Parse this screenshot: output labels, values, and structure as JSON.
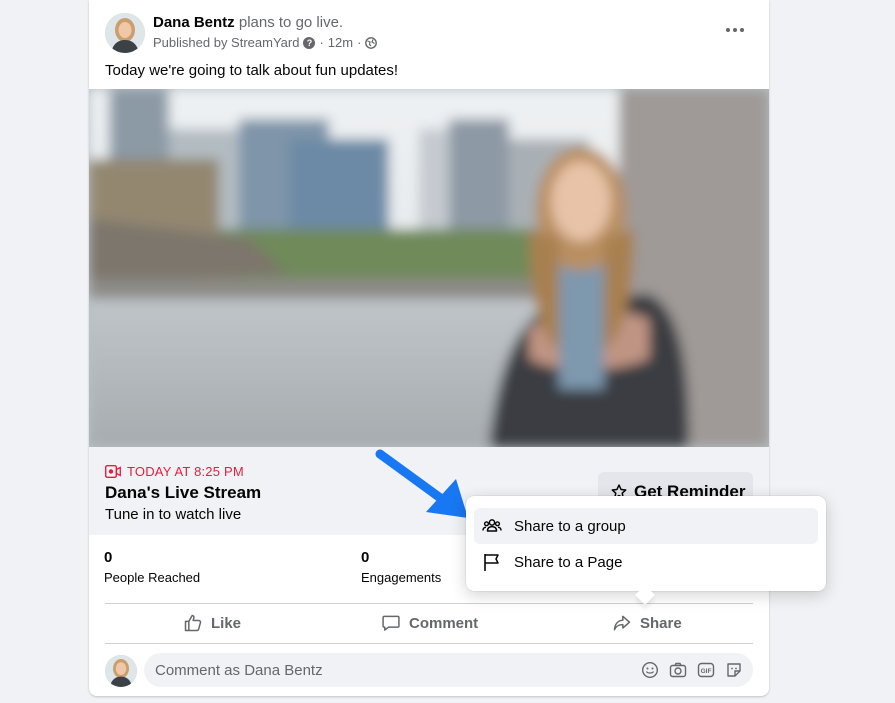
{
  "post": {
    "author": "Dana Bentz",
    "verb": "plans to go live.",
    "published_by": "Published by StreamYard",
    "time": "12m",
    "text": "Today we're going to talk about fun updates!"
  },
  "event": {
    "when": "TODAY AT 8:25 PM",
    "title": "Dana's Live Stream",
    "subtitle": "Tune in to watch live",
    "reminder_label": "Get Reminder"
  },
  "stats": [
    {
      "value": "0",
      "label": "People Reached"
    },
    {
      "value": "0",
      "label": "Engagements"
    }
  ],
  "actions": {
    "like": "Like",
    "comment": "Comment",
    "share": "Share"
  },
  "comment_box": {
    "placeholder": "Comment as Dana Bentz"
  },
  "share_menu": {
    "items": [
      {
        "label": "Share to a group",
        "icon": "group-icon"
      },
      {
        "label": "Share to a Page",
        "icon": "flag-icon"
      }
    ]
  },
  "colors": {
    "event_red": "#e41e3f",
    "annotation_arrow": "#1877f2",
    "muted_text": "#65676b"
  }
}
